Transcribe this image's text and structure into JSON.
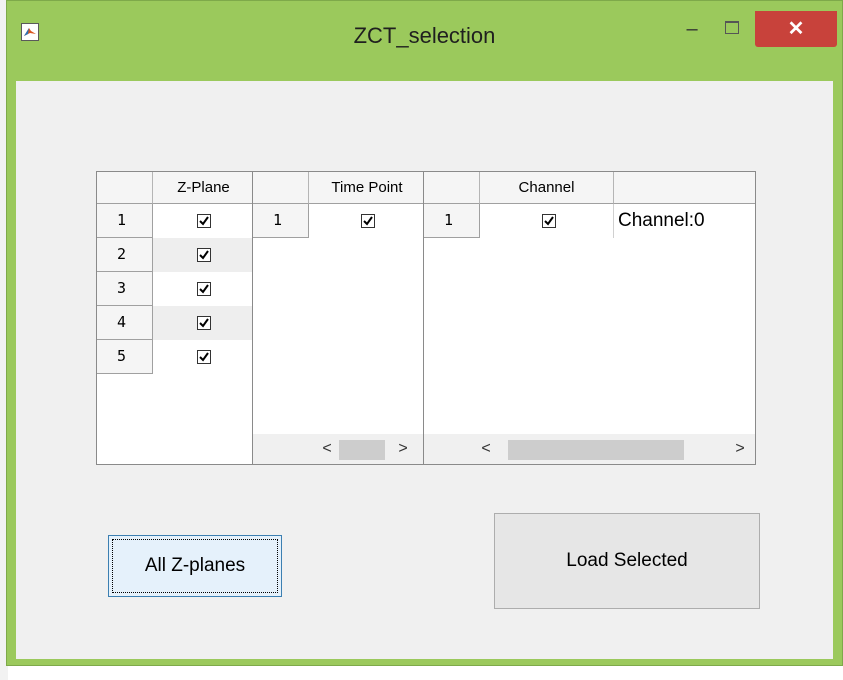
{
  "window": {
    "title": "ZCT_selection"
  },
  "titlebar": {
    "minimize_label": "–",
    "close_label": "✕"
  },
  "icons": {
    "app": "matlab-icon",
    "minimize": "minimize-icon",
    "maximize": "maximize-icon",
    "close": "close-icon"
  },
  "colors": {
    "title_bg": "#9bc95c",
    "close_bg": "#c8423b",
    "client_bg": "#f0f0f0",
    "primary_button_bg": "#e5f1fb"
  },
  "zplane_table": {
    "header": "Z-Plane",
    "rows": [
      {
        "index": "1",
        "checked": true
      },
      {
        "index": "2",
        "checked": true
      },
      {
        "index": "3",
        "checked": true
      },
      {
        "index": "4",
        "checked": true
      },
      {
        "index": "5",
        "checked": true
      }
    ]
  },
  "time_table": {
    "header": "Time Point",
    "rows": [
      {
        "index": "1",
        "checked": true
      }
    ],
    "scroll_left": "<",
    "scroll_right": ">"
  },
  "channel_table": {
    "header": "Channel",
    "rows": [
      {
        "index": "1",
        "checked": true,
        "name": "Channel:0"
      }
    ],
    "scroll_left": "<",
    "scroll_right": ">"
  },
  "buttons": {
    "all_zplanes": "All Z-planes",
    "load_selected": "Load Selected"
  }
}
